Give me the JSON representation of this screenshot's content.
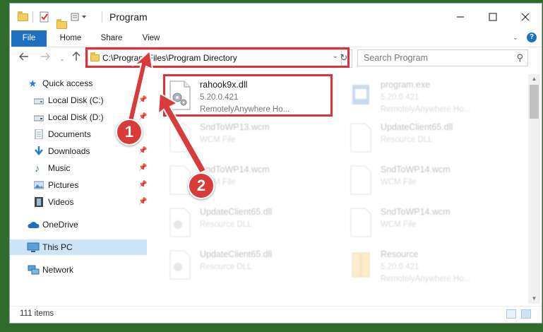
{
  "window": {
    "title": "Program"
  },
  "ribbon": {
    "tabs": [
      "File",
      "Home",
      "Share",
      "View"
    ]
  },
  "address": {
    "path": "C:\\Program Files\\Program Directory"
  },
  "search": {
    "placeholder": "Search Program"
  },
  "sidebar": {
    "items": [
      {
        "label": "Quick access",
        "icon": "star-icon"
      },
      {
        "label": "Local Disk (C:)",
        "icon": "drive-icon"
      },
      {
        "label": "Local Disk (D:)",
        "icon": "drive-icon"
      },
      {
        "label": "Documents",
        "icon": "documents-icon"
      },
      {
        "label": "Downloads",
        "icon": "download-icon"
      },
      {
        "label": "Music",
        "icon": "music-icon"
      },
      {
        "label": "Pictures",
        "icon": "pictures-icon"
      },
      {
        "label": "Videos",
        "icon": "videos-icon"
      },
      {
        "label": "OneDrive",
        "icon": "cloud-icon"
      },
      {
        "label": "This PC",
        "icon": "pc-icon"
      },
      {
        "label": "Network",
        "icon": "network-icon"
      }
    ]
  },
  "files": [
    {
      "name": "rahook9x.dll",
      "line2": "5.20.0.421",
      "line3": "RemotelyAnywhere Ho...",
      "icon": "dll-gear-icon"
    },
    {
      "name": "program.exe",
      "line2": "5.20.0.421",
      "line3": "RemotelyAnywhere Ho...",
      "icon": "exe-icon"
    },
    {
      "name": "SndToWP13.wcm",
      "line2": "WCM File",
      "line3": "",
      "icon": "file-icon"
    },
    {
      "name": "UpdateClient65.dll",
      "line2": "Resource DLL",
      "line3": "",
      "icon": "file-icon"
    },
    {
      "name": "SndToWP14.wcm",
      "line2": "WCM File",
      "line3": "",
      "icon": "file-icon"
    },
    {
      "name": "SndToWP14.wcm",
      "line2": "WCM File",
      "line3": "",
      "icon": "file-icon"
    },
    {
      "name": "UpdateClient65.dll",
      "line2": "Resource DLL",
      "line3": "",
      "icon": "dll-gear-icon"
    },
    {
      "name": "SndToWP14.wcm",
      "line2": "WCM File",
      "line3": "",
      "icon": "file-icon"
    },
    {
      "name": "UpdateClient65.dll",
      "line2": "Resource DLL",
      "line3": "",
      "icon": "dll-gear-icon"
    },
    {
      "name": "Resource",
      "line2": "5.20.0.421",
      "line3": "RemotelyAnywhere Ho...",
      "icon": "archive-icon"
    }
  ],
  "status": {
    "count": "111 items"
  },
  "annotations": {
    "badge1": "1",
    "badge2": "2",
    "highlight_color": "#e0303a",
    "arrow_color": "#d93a3a"
  }
}
